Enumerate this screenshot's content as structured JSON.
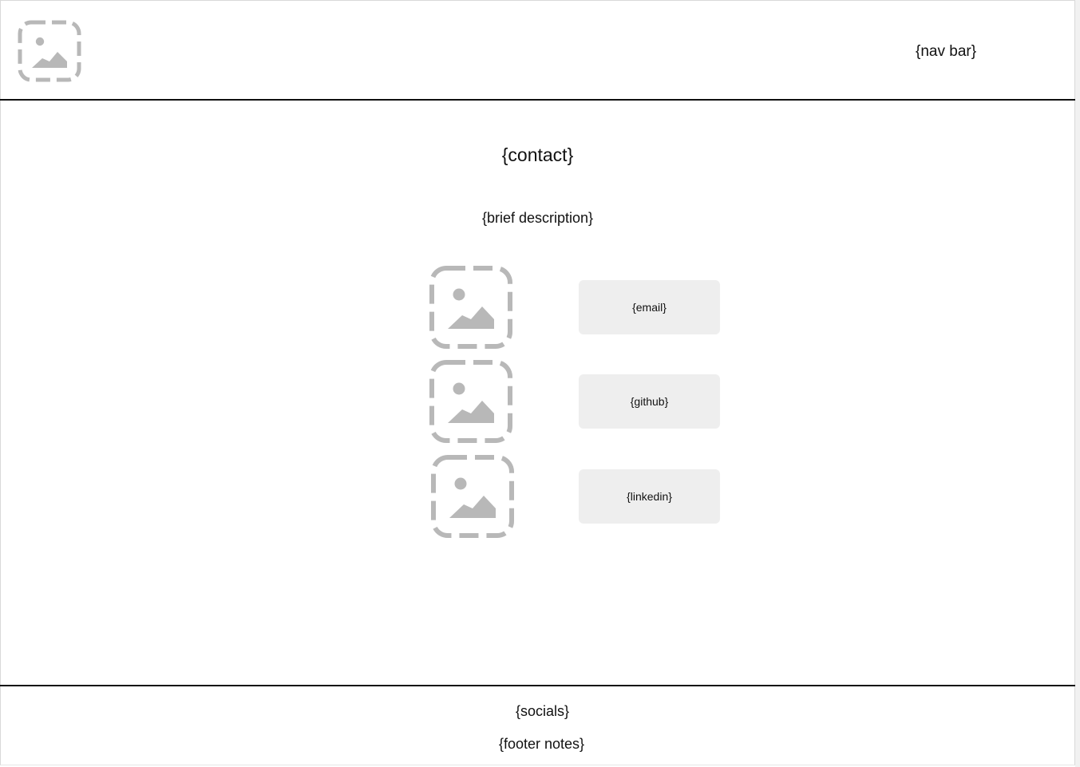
{
  "colors": {
    "background": "#ffffff",
    "placeholder_icon": "#b8b8b8",
    "button_background": "#eeeeee",
    "rule": "#111111"
  },
  "header": {
    "logo_icon": "image-placeholder-icon",
    "nav_label": "{nav bar}"
  },
  "main": {
    "title": "{contact}",
    "description": "{brief description}",
    "contacts": [
      {
        "icon": "image-placeholder-icon",
        "label": "{email}"
      },
      {
        "icon": "image-placeholder-icon",
        "label": "{github}"
      },
      {
        "icon": "image-placeholder-icon",
        "label": "{linkedin}"
      }
    ]
  },
  "footer": {
    "socials": "{socials}",
    "notes": "{footer notes}"
  }
}
